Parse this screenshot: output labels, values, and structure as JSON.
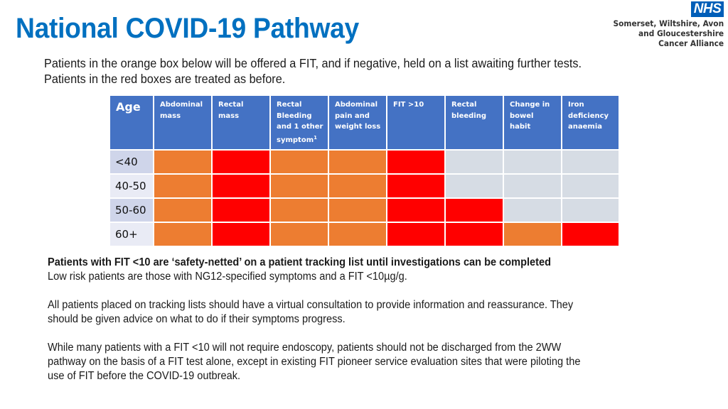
{
  "header": {
    "title": "National COVID-19 Pathway",
    "intro_lines": [
      "Patients in the orange box below will be offered a FIT, and if negative, held on a list awaiting further tests.",
      "Patients in the red boxes are treated as before."
    ]
  },
  "logo": {
    "icon": "nhs-logo",
    "badge": "NHS",
    "lines": [
      "Somerset, Wiltshire, Avon",
      "and Gloucestershire",
      "Cancer Alliance"
    ],
    "brand_color": "#005EB8"
  },
  "colors": {
    "title": "#0070C0",
    "header_bg": "#4472C4",
    "orange": "#ED7D31",
    "red": "#FF0000",
    "grey": "#D6DCE4",
    "age_dark": "#CFD5EA",
    "age_light": "#E9EBF5"
  },
  "table": {
    "age_header": "Age",
    "columns": [
      {
        "label": "Abdominal mass"
      },
      {
        "label": "Rectal mass"
      },
      {
        "label": "Rectal Bleeding and 1 other symptom",
        "footnote": "1"
      },
      {
        "label": "Abdominal pain and weight loss"
      },
      {
        "label": "FIT >10"
      },
      {
        "label": "Rectal bleeding"
      },
      {
        "label": "Change in bowel habit"
      },
      {
        "label": "Iron deficiency anaemia"
      }
    ],
    "rows": [
      {
        "age": "<40",
        "cells": [
          "orange",
          "red",
          "orange",
          "orange",
          "red",
          "grey",
          "grey",
          "grey"
        ]
      },
      {
        "age": "40-50",
        "cells": [
          "orange",
          "red",
          "orange",
          "orange",
          "red",
          "grey",
          "grey",
          "grey"
        ]
      },
      {
        "age": "50-60",
        "cells": [
          "orange",
          "red",
          "orange",
          "orange",
          "red",
          "red",
          "grey",
          "grey"
        ]
      },
      {
        "age": "60+",
        "cells": [
          "orange",
          "red",
          "orange",
          "orange",
          "red",
          "red",
          "orange",
          "red"
        ]
      }
    ]
  },
  "notes": {
    "bold_line": "Patients with FIT <10 are ‘safety-netted’ on a patient tracking list until investigations can be completed",
    "low_risk": "Low risk patients are those with NG12-specified symptoms and a FIT <10µg/g.",
    "para2": [
      "All patients placed on tracking lists should have a virtual consultation to provide information and reassurance. They",
      "should be given advice on what to do if their symptoms progress."
    ],
    "para3": [
      "While many patients with a FIT <10 will not require endoscopy, patients should not be discharged from the 2WW",
      "pathway on the basis of a FIT test alone, except in existing FIT pioneer service evaluation sites that were piloting the",
      "use of FIT before the COVID-19 outbreak."
    ]
  }
}
